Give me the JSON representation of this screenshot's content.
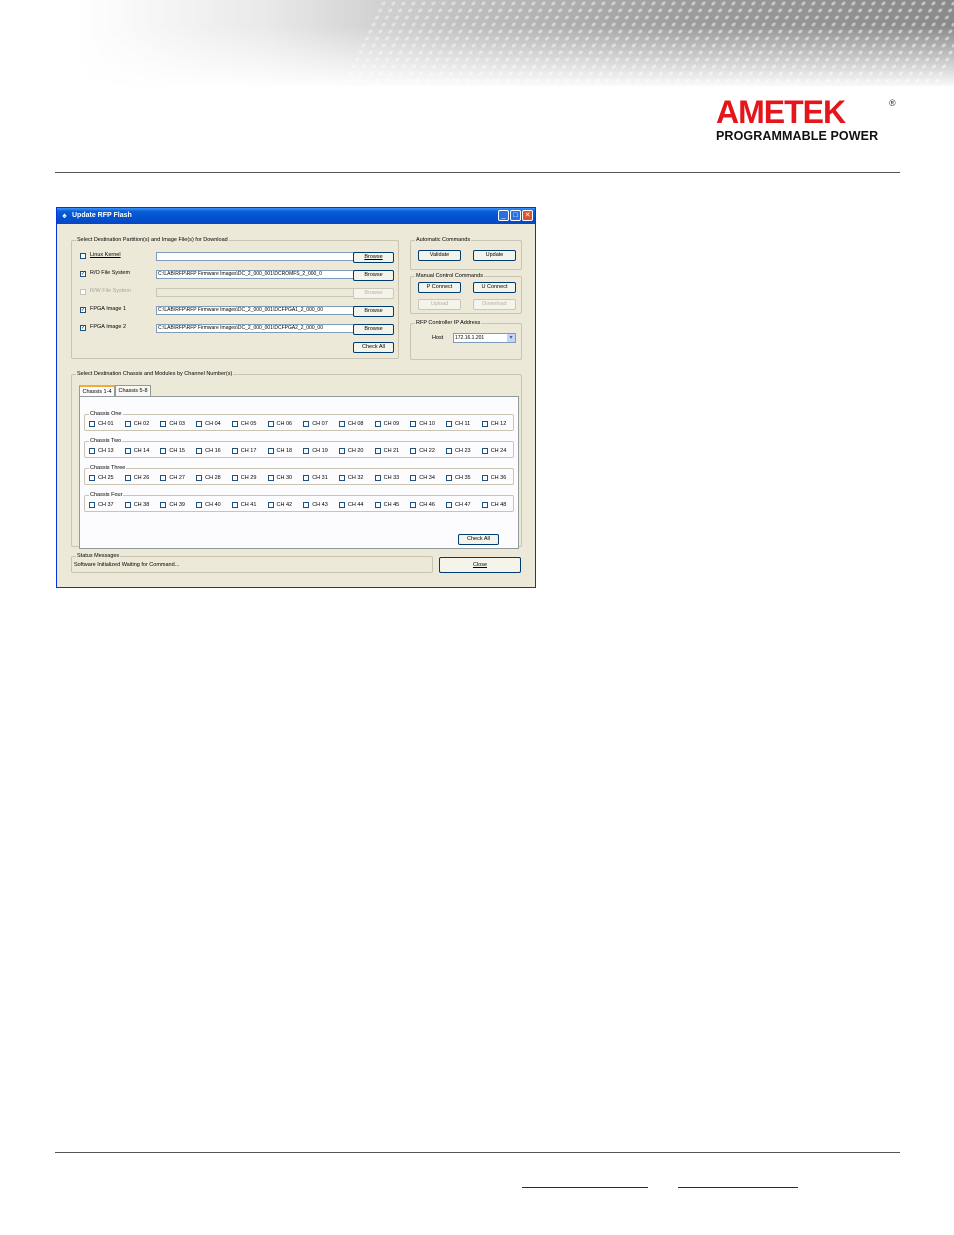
{
  "page": {
    "logo_brand": "AMETEK",
    "logo_reg": "®",
    "logo_sub": "PROGRAMMABLE POWER"
  },
  "window": {
    "title": "Update RFP Flash",
    "app_icon": "app-icon",
    "controls": {
      "minimize": "_",
      "maximize": "□",
      "close": "✕"
    },
    "partitions": {
      "group_label": "Select Destination Partition(s) and Image File(s) for Download",
      "rows": [
        {
          "label": "Linux Kernel",
          "checked": false,
          "enabled": true,
          "path": "",
          "browse": "Browse"
        },
        {
          "label": "R/O File System",
          "checked": true,
          "enabled": true,
          "path": "C:\\LAB\\RFP\\RFP Firmware Images\\DC_2_000_001\\DCROMFS_2_000_0",
          "browse": "Browse"
        },
        {
          "label": "R/W File System",
          "checked": false,
          "enabled": false,
          "path": "",
          "browse": "Browse"
        },
        {
          "label": "FPGA Image 1",
          "checked": true,
          "enabled": true,
          "path": "C:\\LAB\\RFP\\RFP Firmware Images\\DC_2_000_001\\DCFPGA1_2_000_00",
          "browse": "Browse"
        },
        {
          "label": "FPGA Image 2",
          "checked": true,
          "enabled": true,
          "path": "C:\\LAB\\RFP\\RFP Firmware Images\\DC_2_000_001\\DCFPGA2_2_000_00",
          "browse": "Browse"
        }
      ],
      "check_all": "Check All"
    },
    "automatic": {
      "group_label": "Automatic Commands",
      "validate": "Validate",
      "update": "Update"
    },
    "manual": {
      "group_label": "Manual Control Commands",
      "p_connect": "P Connect",
      "u_connect": "U Connect",
      "upload": "Upload",
      "download": "Download"
    },
    "ip": {
      "group_label": "RFP Controller IP Address",
      "host_label": "Host",
      "host_value": "172.16.1.201",
      "dropdown_arrow": "▾"
    },
    "chassis": {
      "group_label": "Select Destination Chassis and Modules by Channel Number(s)",
      "tabs": [
        "Chassis 1-4",
        "Chassis 5-8"
      ],
      "active_tab": "Chassis 1-4",
      "groups": [
        {
          "label": "Chassis One",
          "channels": [
            "CH 01",
            "CH 02",
            "CH 03",
            "CH 04",
            "CH 05",
            "CH 06",
            "CH 07",
            "CH 08",
            "CH 09",
            "CH 10",
            "CH 11",
            "CH 12"
          ]
        },
        {
          "label": "Chassis Two",
          "channels": [
            "CH 13",
            "CH 14",
            "CH 15",
            "CH 16",
            "CH 17",
            "CH 18",
            "CH 19",
            "CH 20",
            "CH 21",
            "CH 22",
            "CH 23",
            "CH 24"
          ]
        },
        {
          "label": "Chassis Three",
          "channels": [
            "CH 25",
            "CH 26",
            "CH 27",
            "CH 28",
            "CH 29",
            "CH 30",
            "CH 31",
            "CH 32",
            "CH 33",
            "CH 34",
            "CH 35",
            "CH 36"
          ]
        },
        {
          "label": "Chassis Four",
          "channels": [
            "CH 37",
            "CH 38",
            "CH 39",
            "CH 40",
            "CH 41",
            "CH 42",
            "CH 43",
            "CH 44",
            "CH 45",
            "CH 46",
            "CH 47",
            "CH 48"
          ]
        }
      ],
      "check_all": "Check All"
    },
    "status": {
      "group_label": "Status Messages",
      "message": "Software Initialized Waiting for Command..."
    },
    "close_button": "Close"
  },
  "colors": {
    "brand_red": "#e4161c",
    "window_face": "#ece9d8",
    "titlebar_blue": "#0052cf",
    "link_blue": "#1a1aa6"
  }
}
